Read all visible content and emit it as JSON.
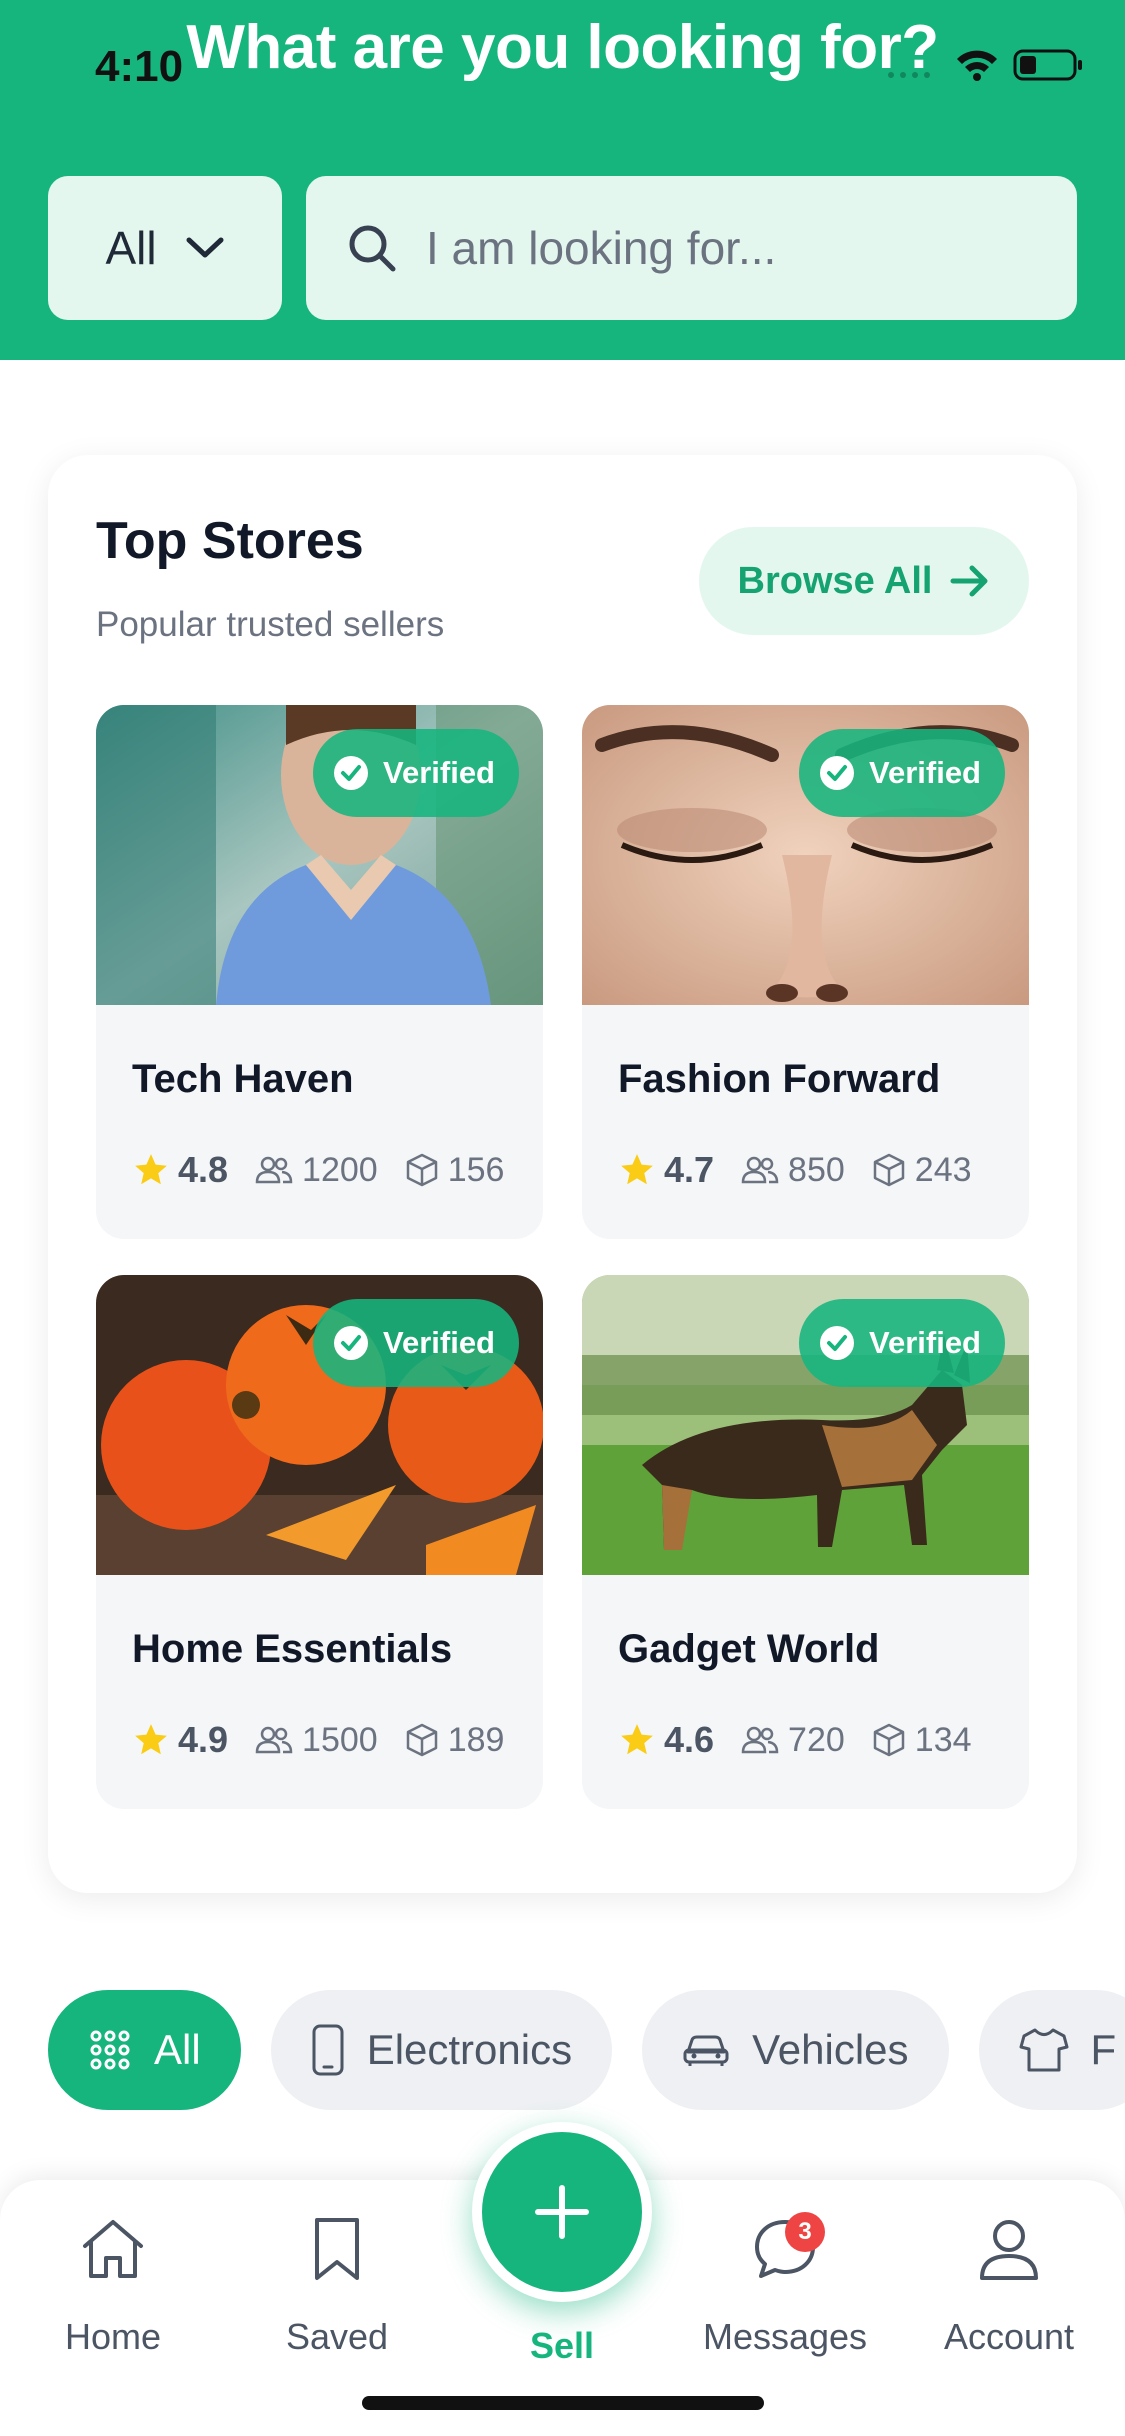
{
  "status_bar": {
    "time": "4:10"
  },
  "header": {
    "title": "What are you looking for?",
    "filter_value": "All",
    "search_placeholder": "I am looking for..."
  },
  "top_stores": {
    "title": "Top Stores",
    "subtitle": "Popular trusted sellers",
    "browse_label": "Browse All",
    "verified_label": "Verified",
    "stores": [
      {
        "name": "Tech Haven",
        "rating": "4.8",
        "followers": "1200",
        "products": "156",
        "image": "nurse-portrait"
      },
      {
        "name": "Fashion Forward",
        "rating": "4.7",
        "followers": "850",
        "products": "243",
        "image": "closed-eyes-closeup"
      },
      {
        "name": "Home Essentials",
        "rating": "4.9",
        "followers": "1500",
        "products": "189",
        "image": "persimmons"
      },
      {
        "name": "Gadget World",
        "rating": "4.6",
        "followers": "720",
        "products": "134",
        "image": "german-shepherd"
      }
    ]
  },
  "categories": [
    {
      "label": "All",
      "icon": "grid-icon",
      "active": true
    },
    {
      "label": "Electronics",
      "icon": "phone-icon",
      "active": false
    },
    {
      "label": "Vehicles",
      "icon": "car-icon",
      "active": false
    },
    {
      "label": "F",
      "icon": "shirt-icon",
      "active": false
    }
  ],
  "bottom_nav": {
    "home": "Home",
    "saved": "Saved",
    "sell": "Sell",
    "messages": "Messages",
    "messages_badge": "3",
    "account": "Account"
  },
  "colors": {
    "brand": "#16b57e",
    "brand_light": "#e4f7ef",
    "star": "#facc15",
    "badge": "#ef4444"
  }
}
